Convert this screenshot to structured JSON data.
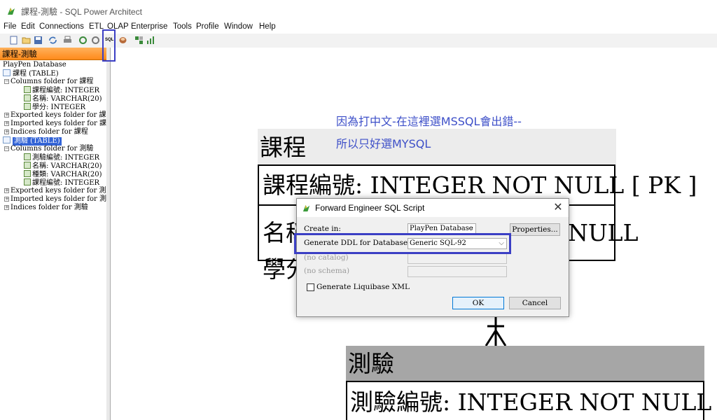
{
  "window": {
    "title": "課程-測驗 - SQL Power Architect"
  },
  "menu": [
    "File",
    "Edit",
    "Connections",
    "ETL",
    "OLAP",
    "Enterprise",
    "Tools",
    "Profile",
    "Window",
    "Help"
  ],
  "toolbar": {
    "icons": [
      "new-project-icon",
      "open-project-icon",
      "save-project-icon",
      "refresh-icon",
      "print-icon",
      "undo-icon",
      "redo-icon",
      "forward-engineer-sql-icon",
      "compare-dm-icon",
      "kettle-job-icon",
      "profile-icon"
    ],
    "sql_label": "SQL"
  },
  "tree": {
    "tab_label": "課程-測驗",
    "root": "PlayPen Database",
    "rows": [
      {
        "label": "課程 (TABLE)"
      },
      {
        "label": "Columns folder for 課程"
      },
      {
        "label": "課程編號: INTEGER"
      },
      {
        "label": "名稱: VARCHAR(20)"
      },
      {
        "label": "學分: INTEGER"
      },
      {
        "label": "Exported keys folder for 課程"
      },
      {
        "label": "Imported keys folder for 課程"
      },
      {
        "label": "Indices folder for 課程"
      },
      {
        "label": "測驗 (TABLE)"
      },
      {
        "label": "Columns folder for 測驗"
      },
      {
        "label": "測驗編號: INTEGER"
      },
      {
        "label": "名稱: VARCHAR(20)"
      },
      {
        "label": "種類: VARCHAR(20)"
      },
      {
        "label": "課程編號: INTEGER"
      },
      {
        "label": "Exported keys folder for 測驗"
      },
      {
        "label": "Imported keys folder for 測驗"
      },
      {
        "label": "Indices folder for 測驗"
      }
    ]
  },
  "canvas": {
    "note_line1": "因為打中文-在這裡選MSSQL會出錯--",
    "note_line2": "所以只好選MYSQL",
    "table1": {
      "name": "課程",
      "pk_row": "課程編號: INTEGER   NOT NULL  [ PK ]",
      "row2_left": "名稱",
      "row2_right": "NULL",
      "row3_left": "學分"
    },
    "table2": {
      "name": "測驗",
      "pk_row": "測驗編號: INTEGER   NOT NULL"
    }
  },
  "dialog": {
    "title": "Forward Engineer SQL Script",
    "create_in_label": "Create in:",
    "create_in_value": "PlayPen Database",
    "properties_button": "Properties...",
    "ddl_label": "Generate DDL for Database Type:",
    "ddl_value": "Generic SQL-92",
    "catalog_label": "(no catalog)",
    "schema_label": "(no schema)",
    "liquibase_label": "Generate Liquibase XML",
    "liquibase_checked": false,
    "ok_button": "OK",
    "cancel_button": "Cancel"
  },
  "colors": {
    "highlight": "#3b3fc4",
    "tab_orange": "#ff8a1a",
    "note_blue": "#3d4fc8",
    "selection": "#3464d6"
  }
}
